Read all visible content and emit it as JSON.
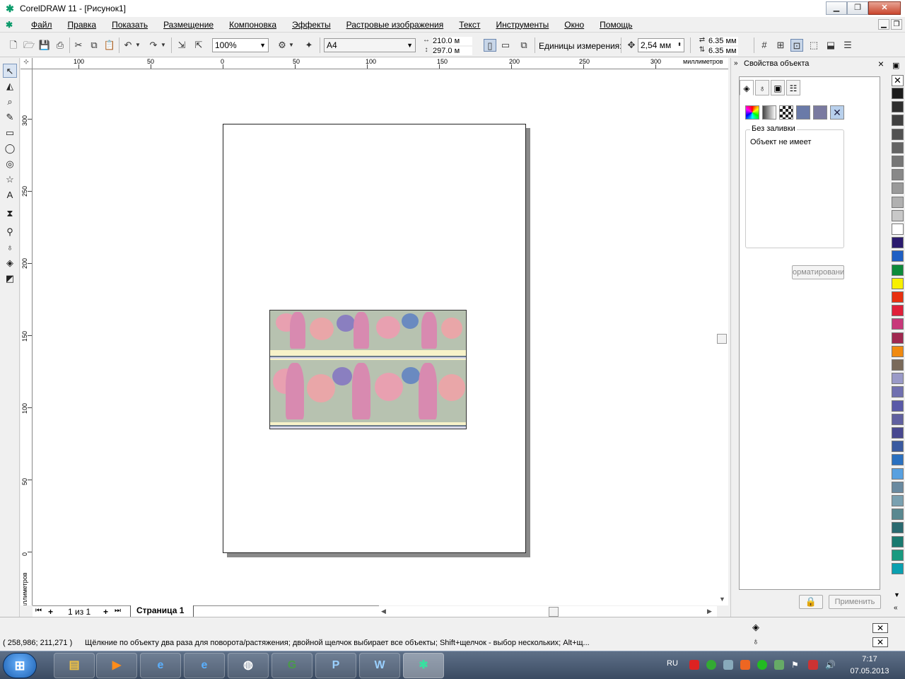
{
  "window": {
    "title": "CorelDRAW 11 - [Рисунок1]",
    "controls": [
      "minimize",
      "maximize",
      "close"
    ]
  },
  "menu": {
    "items": [
      "Файл",
      "Правка",
      "Показать",
      "Размещение",
      "Компоновка",
      "Эффекты",
      "Растровые изображения",
      "Текст",
      "Инструменты",
      "Окно",
      "Помощь"
    ]
  },
  "toolbar": {
    "zoom": "100%",
    "paper_size": "A4",
    "page_width": "210.0 м",
    "page_height": "297.0 м",
    "units_label": "Единицы измерения:",
    "nudge": "2,54 мм",
    "duplicate_x": "6.35 мм",
    "duplicate_y": "6.35 мм"
  },
  "rulers": {
    "top_labels": [
      "100",
      "50",
      "0",
      "50",
      "100",
      "150",
      "200",
      "250",
      "300"
    ],
    "top_unit": "миллиметров",
    "left_labels": [
      "300",
      "250",
      "200",
      "150",
      "100",
      "50",
      "0"
    ],
    "left_unit": "миллиметров"
  },
  "pages": {
    "counter": "1 из 1",
    "tab": "Страница 1"
  },
  "docker": {
    "title": "Свойства объекта",
    "fill_heading": "Без заливки",
    "fill_description": "Объект не имеет",
    "format_button": "орматировани",
    "apply_button": "Применить"
  },
  "palette": {
    "colors": [
      "#1c1c1c",
      "#2e2e2e",
      "#404040",
      "#525252",
      "#646464",
      "#767676",
      "#888888",
      "#9a9a9a",
      "#b0b0b0",
      "#c8c8c8",
      "#ffffff",
      "#2a1a6e",
      "#1f5fc4",
      "#0d8a3a",
      "#f8f000",
      "#e83010",
      "#e0203a",
      "#c8387a",
      "#a02850",
      "#f08a10",
      "#7a6a5a",
      "#9a9ac8",
      "#7070b0",
      "#5a5aa8",
      "#6060a0",
      "#484890",
      "#3a5aa0",
      "#2a70c0",
      "#58a0e0",
      "#6a8aa0",
      "#7aa0b0",
      "#5a8890",
      "#2a6a70",
      "#1a7a70",
      "#1a9a80",
      "#0aa0b0"
    ]
  },
  "statusbar": {
    "coords": "( 258,986; 211,271 )",
    "hint": "Щёлкние по объекту два раза для поворота/растяжения; двойной щелчок выбирает все объекты; Shift+щелчок - выбор нескольких; Alt+щ..."
  },
  "taskbar": {
    "lang": "RU",
    "time": "7:17",
    "date": "07.05.2013"
  }
}
